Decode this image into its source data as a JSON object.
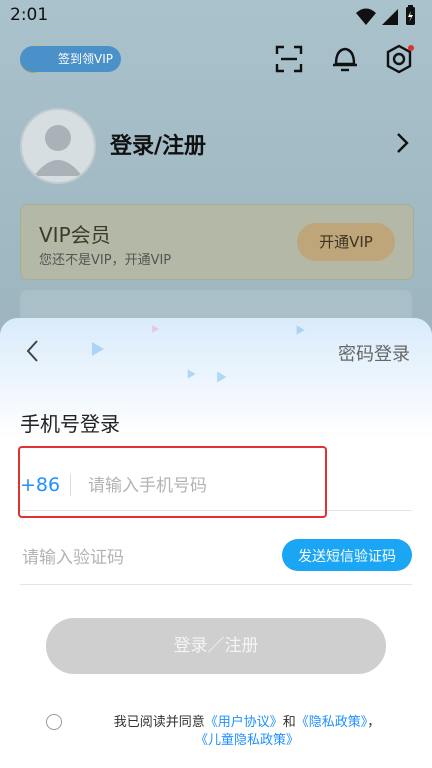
{
  "status_bar": {
    "time": "2:01"
  },
  "header": {
    "vip_signin_label": "签到领VIP"
  },
  "profile": {
    "login_register": "登录/注册"
  },
  "vip_card": {
    "title": "VIP会员",
    "subtitle": "您还不是VIP，开通VIP",
    "open_button": "开通VIP"
  },
  "sheet": {
    "password_login": "密码登录",
    "title": "手机号登录",
    "country_code": "+86",
    "phone_placeholder": "请输入手机号码",
    "code_placeholder": "请输入验证码",
    "send_code": "发送短信验证码",
    "submit": "登录／注册",
    "agreement": {
      "prefix": "我已阅读并同意",
      "user_agreement": "《用户协议》",
      "and": "和",
      "privacy_policy": "《隐私政策》",
      "comma": "，",
      "child_privacy": "《儿童隐私政策》"
    }
  },
  "colors": {
    "accent": "#1aa6f5",
    "link": "#1e90ff",
    "highlight": "#e0322e"
  }
}
